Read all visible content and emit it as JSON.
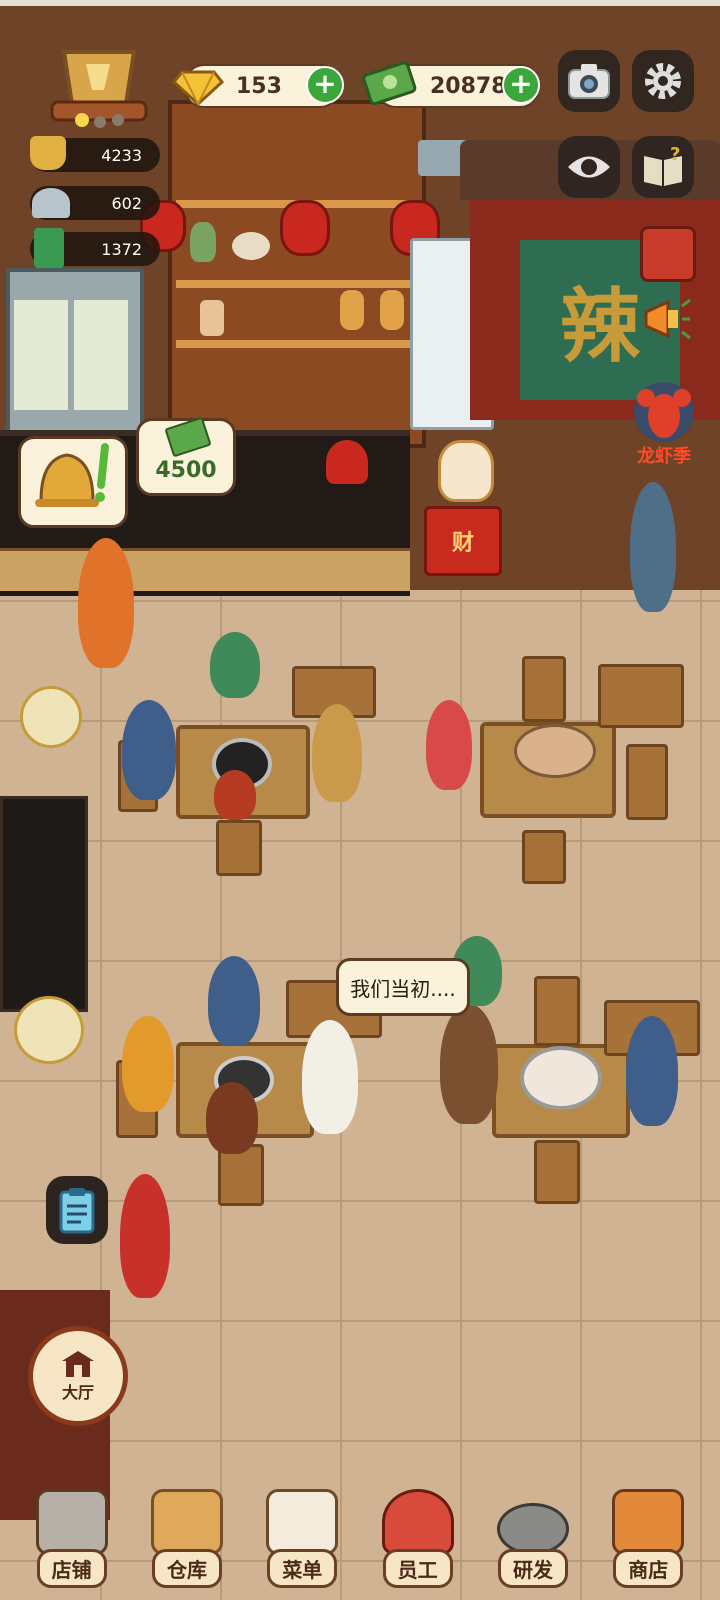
{
  "hud": {
    "gems": "153",
    "cash": "20878",
    "plus": "+",
    "stats": [
      "4233",
      "602",
      "1372"
    ]
  },
  "scene": {
    "sign_char": "辣",
    "cashbox_char": "财",
    "order_bubble_amount": "4500",
    "speech_bubble": "我们当初....",
    "event_label": "龙虾季",
    "hall_button": "大厅"
  },
  "nav": {
    "items": [
      "店铺",
      "仓库",
      "菜单",
      "员工",
      "研发",
      "商店"
    ]
  },
  "icons": [
    "trophy-icon",
    "gem-icon",
    "cash-icon",
    "camera-icon",
    "gear-icon",
    "eye-icon",
    "guide-book-icon",
    "recipe-book-icon",
    "megaphone-icon",
    "lobster-icon",
    "bell-icon",
    "clipboard-icon"
  ],
  "colors": {
    "accent_green": "#3ba63a",
    "panel_cream": "#fbf2dc",
    "wood_dark": "#5b3a22"
  }
}
